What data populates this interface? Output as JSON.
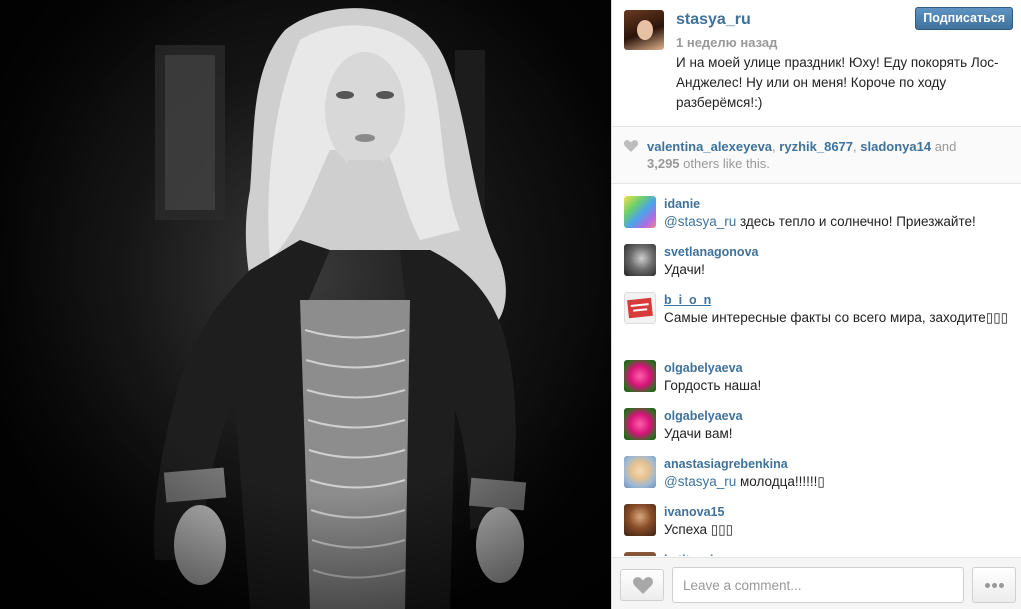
{
  "post": {
    "username": "stasya_ru",
    "time_ago": "1 неделю назад",
    "follow_label": "Подписаться",
    "caption": "И на моей улице праздник! Юху! Еду покорять Лос-Анджелес! Ну или он меня! Короче по ходу разберёмся!:)"
  },
  "likes": {
    "users": [
      "valentina_alexeyeva",
      "ryzhik_8677",
      "sladonya14"
    ],
    "sep": ", ",
    "and": " and",
    "count": "3,295",
    "rest": " others like this."
  },
  "comments": [
    {
      "user": "idanie",
      "mention": "@stasya_ru",
      "text": " здесь тепло и солнечно! Приезжайте!"
    },
    {
      "user": "svetlanagonova",
      "mention": "",
      "text": "Удачи!"
    },
    {
      "user": "b_i_o_n",
      "mention": "",
      "text": "Самые интересные факты со всего мира, заходите▯▯▯"
    },
    {
      "user": "olgabelyaeva",
      "mention": "",
      "text": "Гордость наша!"
    },
    {
      "user": "olgabelyaeva",
      "mention": "",
      "text": "Удачи вам!"
    },
    {
      "user": "anastasiagrebenkina",
      "mention": "@stasya_ru",
      "text": " молодца!!!!!!▯"
    },
    {
      "user": "ivanova15",
      "mention": "",
      "text": "Успеха ▯▯▯"
    },
    {
      "user": "katitropina",
      "mention": "",
      "text": ""
    }
  ],
  "footer": {
    "comment_placeholder": "Leave a comment...",
    "like_icon": "heart-icon",
    "more_icon": "ellipsis-icon"
  },
  "colors": {
    "link": "#3f729b",
    "follow_button": "#3f729b",
    "muted": "#999999"
  }
}
